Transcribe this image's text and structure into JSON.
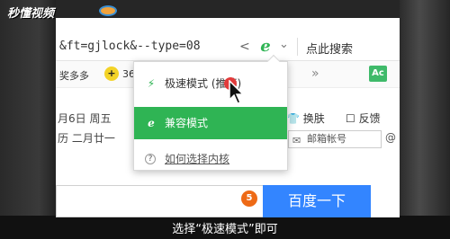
{
  "watermark": {
    "logo_text": "秒懂视频"
  },
  "addressbar": {
    "url_text": "&ft=gjlock&--type=08",
    "share_icon": "share-icon",
    "engine_icon": "e",
    "dropdown_icon": "chevron-down-icon",
    "search_label": "点此搜索"
  },
  "bookmarks": {
    "item1": "奖多多",
    "badge": "+",
    "item2": "36",
    "more": "»",
    "right_icon": "Ac"
  },
  "page": {
    "date_line1": "月6日  周五",
    "date_line2": "历 二月廿一",
    "skin_label": "换肤",
    "feedback_label": "反馈",
    "mail_placeholder": "邮箱帐号",
    "at_symbol": "@"
  },
  "menu": {
    "items": [
      {
        "icon": "lightning-icon",
        "glyph": "⚡",
        "label": "极速模式 (推荐)"
      },
      {
        "icon": "ie-icon",
        "glyph": "e",
        "label": "兼容模式"
      },
      {
        "icon": "help-icon",
        "glyph": "?",
        "label": "如何选择内核"
      }
    ]
  },
  "search": {
    "step_badge": "5",
    "button_label": "百度一下"
  },
  "caption": "选择“极速模式”即可",
  "colors": {
    "green": "#2fb454",
    "blue": "#3385ff",
    "orange": "#ee6a16"
  }
}
